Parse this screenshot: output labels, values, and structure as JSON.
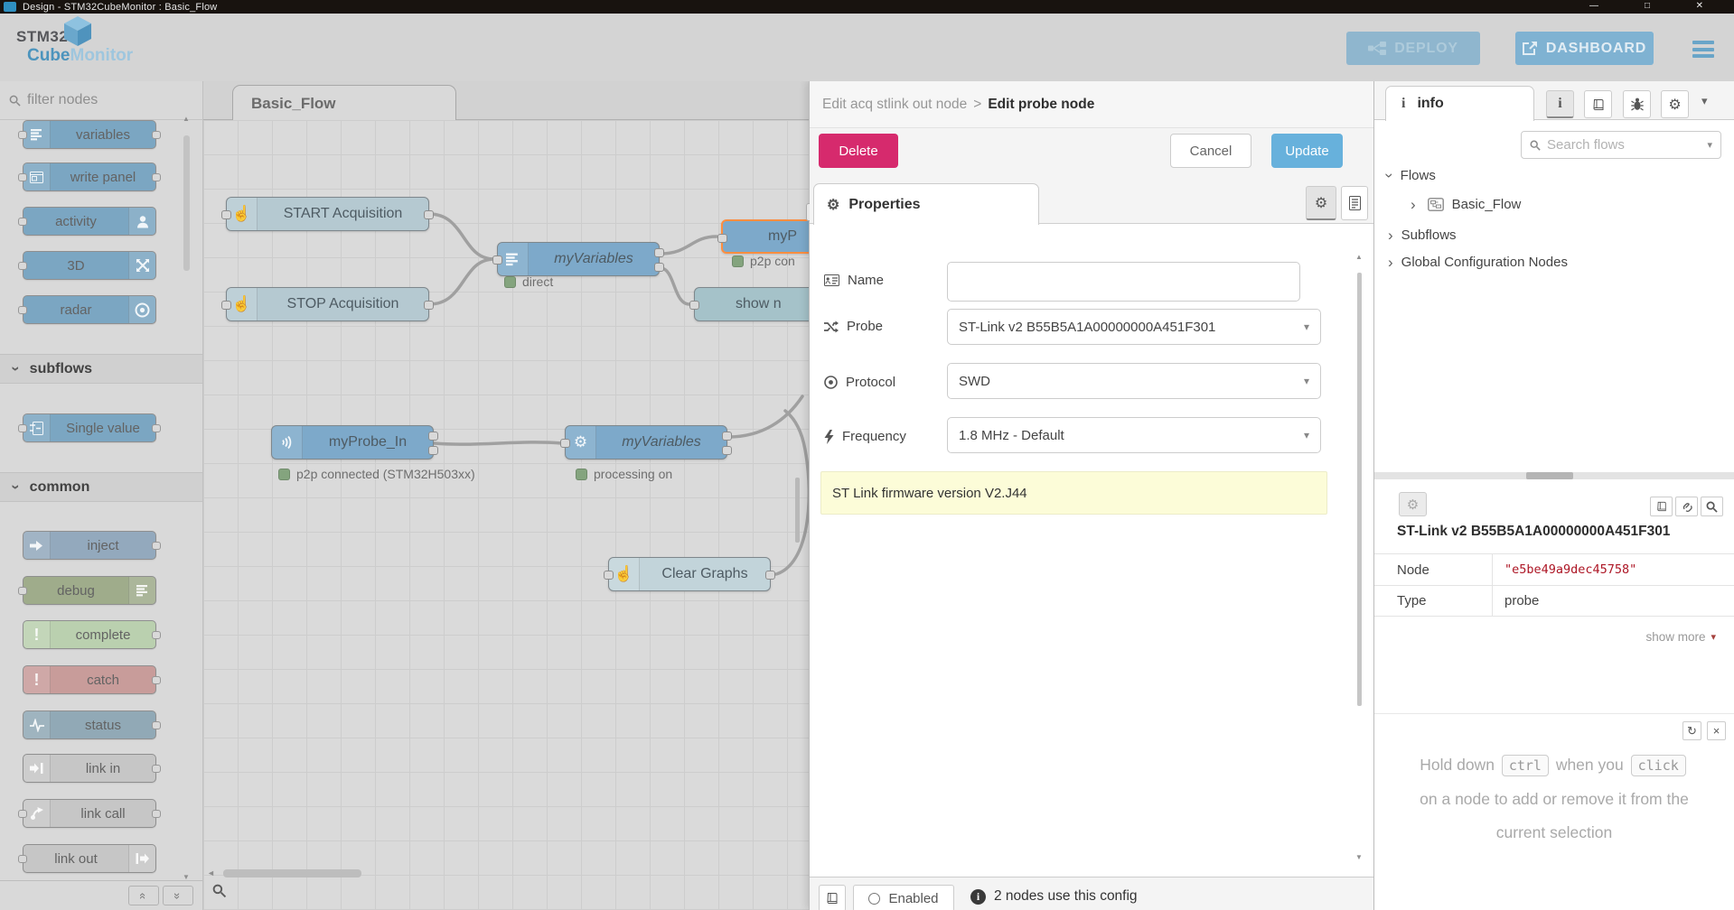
{
  "titlebar": {
    "title": "Design - STM32CubeMonitor : Basic_Flow"
  },
  "header": {
    "logo": {
      "stm32": "STM32",
      "cube": "Cube",
      "monitor": "Monitor"
    },
    "deploy_label": "DEPLOY",
    "dashboard_label": "DASHBOARD"
  },
  "palette": {
    "filter_placeholder": "filter nodes",
    "sections": {
      "subflows": "subflows",
      "common": "common"
    },
    "items": [
      {
        "label": "variables",
        "color": "#7ba6c2"
      },
      {
        "label": "write panel",
        "color": "#7ba6c2"
      },
      {
        "label": "activity",
        "color": "#7ba6c2"
      },
      {
        "label": "3D",
        "color": "#7ba6c2"
      },
      {
        "label": "radar",
        "color": "#7ba6c2"
      },
      {
        "label": "Single value",
        "color": "#7ba6c2"
      },
      {
        "label": "inject",
        "color": "#93a9bd"
      },
      {
        "label": "debug",
        "color": "#9fac8b"
      },
      {
        "label": "complete",
        "color": "#bad0af"
      },
      {
        "label": "catch",
        "color": "#c89c9a"
      },
      {
        "label": "status",
        "color": "#91a9b6"
      },
      {
        "label": "link in",
        "color": "#c6c6c6"
      },
      {
        "label": "link call",
        "color": "#c6c6c6"
      },
      {
        "label": "link out",
        "color": "#c6c6c6"
      }
    ]
  },
  "canvas": {
    "tab_label": "Basic_Flow",
    "status_dot_color": "#84a47e",
    "nodes": [
      {
        "label": "START Acquisition",
        "color": "#b5c9d1"
      },
      {
        "label": "STOP Acquisition",
        "color": "#b5c9d1"
      },
      {
        "label": "myVariables",
        "color": "#7da9ca",
        "status": "direct"
      },
      {
        "label": "myP",
        "color": "#7da9ca",
        "status": "p2p con"
      },
      {
        "label": "show n",
        "color": "#a5c2c9"
      },
      {
        "label": "myProbe_In",
        "color": "#7da9ca",
        "status": "p2p connected (STM32H503xx)"
      },
      {
        "label": "myVariables",
        "color": "#7da9ca",
        "status": "processing on"
      },
      {
        "label": "Clear Graphs",
        "color": "#c2d4da"
      }
    ]
  },
  "tray": {
    "breadcrumb": {
      "parent": "Edit acq stlink out node",
      "separator": ">",
      "current": "Edit probe node"
    },
    "buttons": {
      "delete": "Delete",
      "cancel": "Cancel",
      "update": "Update"
    },
    "tab_label": "Properties",
    "fields": {
      "name": {
        "label": "Name",
        "value": ""
      },
      "probe": {
        "label": "Probe",
        "value": "ST-Link v2 B55B5A1A00000000A451F301"
      },
      "protocol": {
        "label": "Protocol",
        "value": "SWD"
      },
      "frequency": {
        "label": "Frequency",
        "value": "1.8 MHz - Default"
      }
    },
    "firmware_message": "ST Link firmware version V2.J44",
    "footer": {
      "enabled_label": "Enabled",
      "usage_text": "2 nodes use this config"
    },
    "colors": {
      "delete_bg": "#d62a6d",
      "update_bg": "#67b1dc",
      "message_bg": "#fcfcd8"
    }
  },
  "sidebar": {
    "tab_label": "info",
    "search_placeholder": "Search flows",
    "tree": {
      "flows": "Flows",
      "flow_name": "Basic_Flow",
      "subflows": "Subflows",
      "global_config": "Global Configuration Nodes"
    },
    "details": {
      "title": "ST-Link v2 B55B5A1A00000000A451F301",
      "value_color": "#ad1625",
      "rows": [
        {
          "key": "Node",
          "value": "\"e5be49a9dec45758\""
        },
        {
          "key": "Type",
          "value": "probe"
        }
      ],
      "show_more": "show more"
    },
    "help": {
      "part1": "Hold down",
      "key1": "ctrl",
      "part2": "when you",
      "key2": "click",
      "part3": "on a node to add or remove it from the",
      "part4": "current selection"
    }
  }
}
